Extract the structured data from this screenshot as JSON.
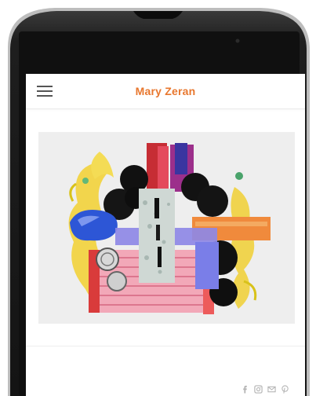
{
  "header": {
    "title": "Mary Zeran",
    "title_color": "#e8772e",
    "menu_icon": "hamburger-menu-icon"
  },
  "colors": {
    "phone_body": "#1b1b1b",
    "phone_bezel": "#2a2a2a",
    "screen_bg": "#ffffff"
  },
  "social": {
    "icons": [
      "facebook-icon",
      "instagram-icon",
      "email-icon",
      "pinterest-icon"
    ]
  }
}
